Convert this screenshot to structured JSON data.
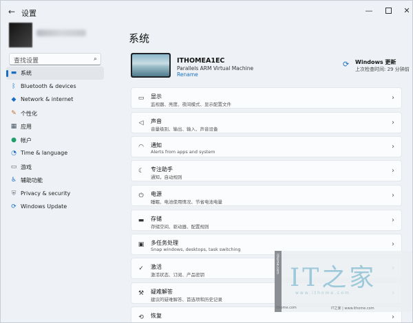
{
  "window": {
    "title": "设置",
    "back_icon": "arrow-left-icon",
    "controls": [
      "minimize-icon",
      "maximize-icon",
      "close-icon"
    ]
  },
  "sidebar": {
    "search_placeholder": "查找设置",
    "items": [
      {
        "label": "系统",
        "icon": "monitor-icon",
        "active": true
      },
      {
        "label": "Bluetooth & devices",
        "icon": "bluetooth-icon"
      },
      {
        "label": "Network & internet",
        "icon": "wifi-icon"
      },
      {
        "label": "个性化",
        "icon": "brush-icon"
      },
      {
        "label": "应用",
        "icon": "apps-icon"
      },
      {
        "label": "帐户",
        "icon": "person-icon"
      },
      {
        "label": "Time & language",
        "icon": "globe-clock-icon"
      },
      {
        "label": "游戏",
        "icon": "gamepad-icon"
      },
      {
        "label": "辅助功能",
        "icon": "accessibility-icon"
      },
      {
        "label": "Privacy & security",
        "icon": "shield-icon"
      },
      {
        "label": "Windows Update",
        "icon": "update-icon"
      }
    ]
  },
  "main": {
    "title": "系统",
    "device": {
      "name": "ITHOMEA1EC",
      "model": "Parallels ARM Virtual Machine",
      "rename": "Rename"
    },
    "update": {
      "title": "Windows 更新",
      "subtitle": "上次检查时间: 29 分钟前"
    },
    "cards": [
      {
        "title": "显示",
        "sub": "监视器、亮度、夜间模式、显示配置文件",
        "icon": "display-icon"
      },
      {
        "title": "声音",
        "sub": "音量级别、输出、输入、声音设备",
        "icon": "speaker-icon"
      },
      {
        "title": "通知",
        "sub": "Alerts from apps and system",
        "icon": "bell-icon"
      },
      {
        "title": "专注助手",
        "sub": "通知，自动规则",
        "icon": "moon-icon"
      },
      {
        "title": "电源",
        "sub": "睡眠、电池使用情况、节省电池电量",
        "icon": "power-icon"
      },
      {
        "title": "存储",
        "sub": "存储空间、驱动器、配置规则",
        "icon": "storage-icon"
      },
      {
        "title": "多任务处理",
        "sub": "Snap windows, desktops, task switching",
        "icon": "multitask-icon"
      },
      {
        "title": "激活",
        "sub": "激活状态、订阅、产品密钥",
        "icon": "check-circle-icon"
      },
      {
        "title": "疑难解答",
        "sub": "建议的疑难解答、首选项和历史记录",
        "icon": "wrench-icon"
      },
      {
        "title": "恢复",
        "sub": "",
        "icon": "recovery-icon"
      }
    ]
  },
  "watermark": {
    "logo": "IT之家",
    "url": "www.ithome.com",
    "left_text": "ithome.com",
    "bottom_left": "ithome.com",
    "bottom_right": "IT之家 | www.ithome.com"
  }
}
